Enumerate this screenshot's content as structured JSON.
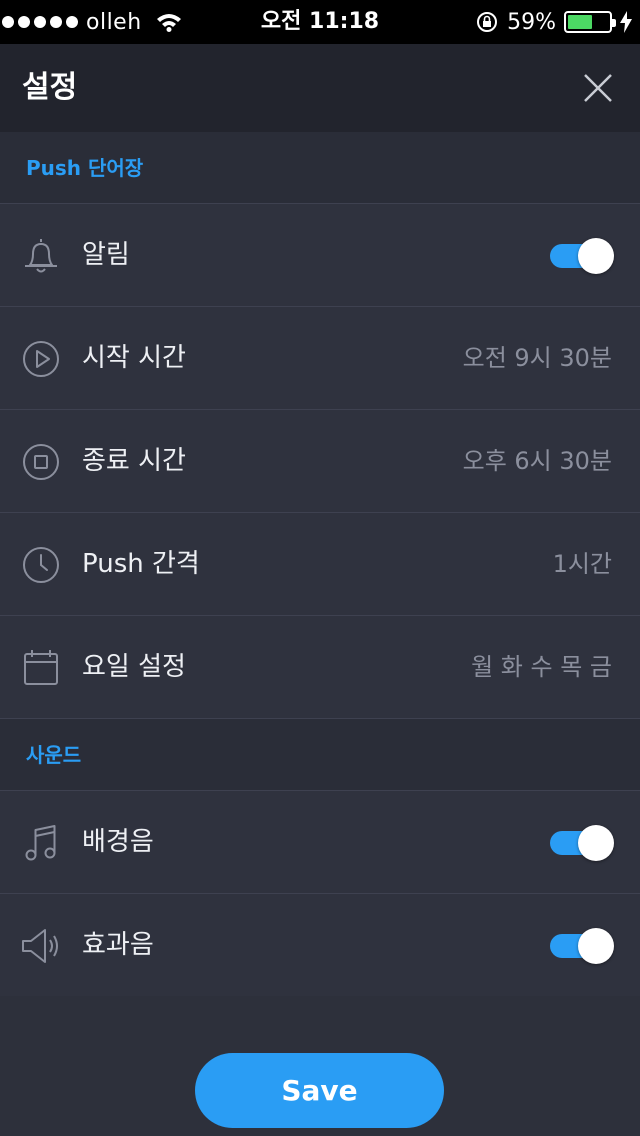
{
  "status_bar": {
    "carrier": "olleh",
    "time": "오전 11:18",
    "battery_percent": "59%",
    "battery_level": 0.59,
    "battery_color": "#4cd964"
  },
  "header": {
    "title": "설정",
    "close_icon": "close-icon"
  },
  "sections": [
    {
      "title": "Push 단어장",
      "rows": [
        {
          "label": "알림",
          "icon": "bell-icon",
          "type": "toggle",
          "on": true
        },
        {
          "label": "시작 시간",
          "icon": "play-circle-icon",
          "type": "value",
          "value": "오전 9시 30분"
        },
        {
          "label": "종료 시간",
          "icon": "stop-circle-icon",
          "type": "value",
          "value": "오후 6시 30분"
        },
        {
          "label": "Push 간격",
          "icon": "clock-icon",
          "type": "value",
          "value": "1시간"
        },
        {
          "label": "요일 설정",
          "icon": "calendar-icon",
          "type": "value",
          "value": "월 화 수 목 금"
        }
      ]
    },
    {
      "title": "사운드",
      "rows": [
        {
          "label": "배경음",
          "icon": "music-note-icon",
          "type": "toggle",
          "on": true
        },
        {
          "label": "효과음",
          "icon": "speaker-icon",
          "type": "toggle",
          "on": true
        }
      ]
    }
  ],
  "footer": {
    "save_label": "Save"
  },
  "colors": {
    "accent": "#2a9df4",
    "background": "#2d303b",
    "header_bg": "#22242d",
    "value_text": "#8b8f9d"
  }
}
